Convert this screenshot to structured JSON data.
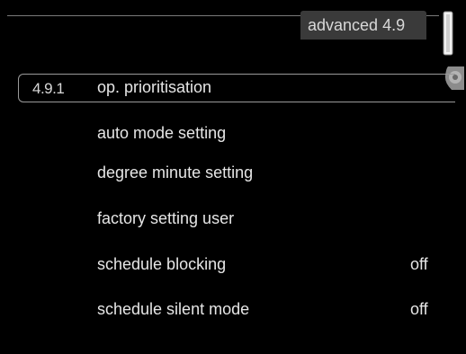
{
  "header": {
    "title": "advanced 4.9"
  },
  "icons": {
    "thermometer": "thermometer-icon",
    "knob": "control-knob-icon"
  },
  "menu": {
    "items": [
      {
        "number": "4.9.1",
        "label": "op. prioritisation",
        "value": "",
        "selected": true
      },
      {
        "number": "",
        "label": "auto mode setting",
        "value": "",
        "selected": false
      },
      {
        "number": "",
        "label": "degree minute setting",
        "value": "",
        "selected": false
      },
      {
        "number": "",
        "label": "factory setting user",
        "value": "",
        "selected": false
      },
      {
        "number": "",
        "label": "schedule blocking",
        "value": "off",
        "selected": false
      },
      {
        "number": "",
        "label": "schedule silent mode",
        "value": "off",
        "selected": false
      }
    ]
  },
  "colors": {
    "background": "#000000",
    "text": "#e6e6e6",
    "tab": "#3a3a3a",
    "frame": "#9a9a9a"
  }
}
